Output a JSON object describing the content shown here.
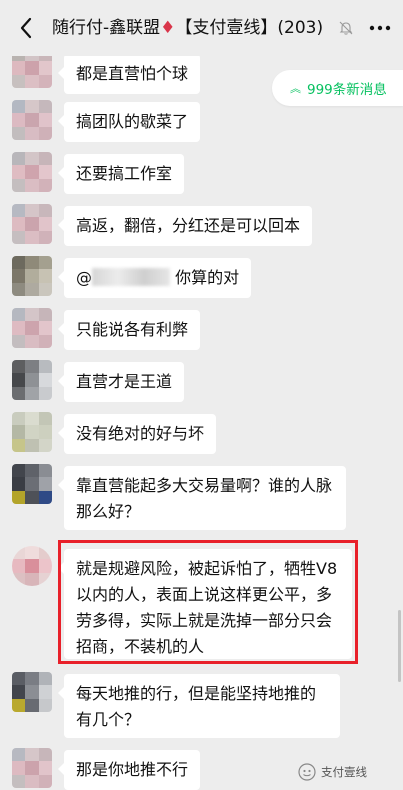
{
  "header": {
    "title_prefix": "随行付-鑫联盟",
    "title_diamond": "♦",
    "title_suffix": "【支付壹线】(203)"
  },
  "new_messages": {
    "label": "999条新消息"
  },
  "messages": [
    {
      "text": "都是直营怕个球"
    },
    {
      "text": "搞团队的歇菜了"
    },
    {
      "text": "还要搞工作室"
    },
    {
      "text": "高返，翻倍，分红还是可以回本"
    },
    {
      "prefix": "@",
      "suffix": "  你算的对"
    },
    {
      "text": "只能说各有利弊"
    },
    {
      "text": "直营才是王道"
    },
    {
      "text": "没有绝对的好与坏"
    },
    {
      "text": "靠直营能起多大交易量啊？谁的人脉那么好？"
    },
    {
      "text": "就是规避风险，被起诉怕了，牺牲V8 以内的人，表面上说这样更公平，多劳多得，实际上就是洗掉一部分只会招商，不装机的人"
    },
    {
      "text": "每天地推的行，但是能坚持地推的有几个？"
    },
    {
      "text": "那是你地推不行"
    }
  ],
  "watermark": {
    "label": "支付壹线"
  }
}
